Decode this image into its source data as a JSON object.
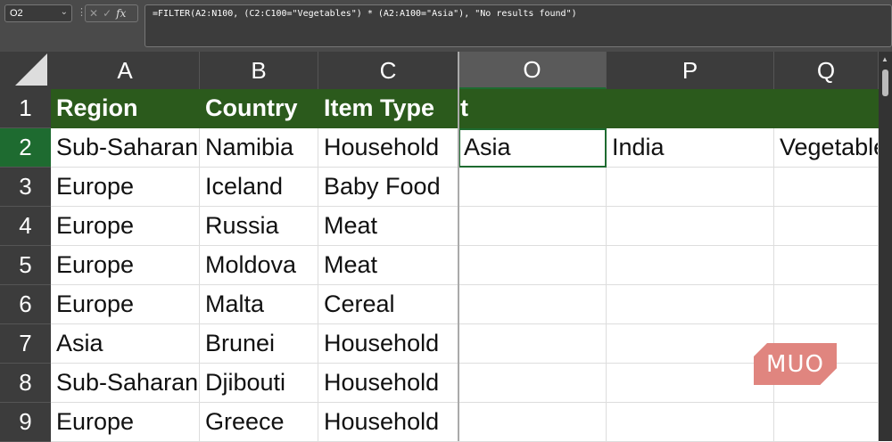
{
  "name_box": "O2",
  "formula": "=FILTER(A2:N100, (C2:C100=\"Vegetables\") * (A2:A100=\"Asia\"), \"No results found\")",
  "columns": [
    "A",
    "B",
    "C",
    "O",
    "P",
    "Q"
  ],
  "rows": [
    "1",
    "2",
    "3",
    "4",
    "5",
    "6",
    "7",
    "8",
    "9"
  ],
  "headers": {
    "A": "Region",
    "B": "Country",
    "C": "Item Type",
    "O": "t"
  },
  "data": [
    [
      "Sub-Saharan Africa",
      "Namibia",
      "Household"
    ],
    [
      "Europe",
      "Iceland",
      "Baby Food"
    ],
    [
      "Europe",
      "Russia",
      "Meat"
    ],
    [
      "Europe",
      "Moldova",
      "Meat"
    ],
    [
      "Europe",
      "Malta",
      "Cereal"
    ],
    [
      "Asia",
      "Brunei",
      "Household"
    ],
    [
      "Sub-Saharan Africa",
      "Djibouti",
      "Household"
    ],
    [
      "Europe",
      "Greece",
      "Household"
    ]
  ],
  "spill": [
    "Asia",
    "India",
    "Vegetables"
  ],
  "watermark": "MUO"
}
